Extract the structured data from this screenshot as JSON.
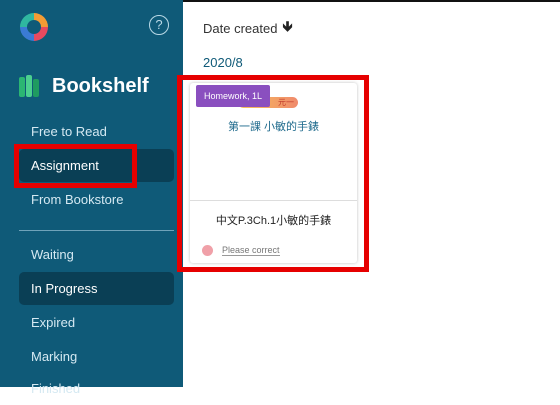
{
  "sidebar": {
    "help_label": "?",
    "brand": "Bookshelf",
    "items_top": [
      "Free to Read",
      "Assignment",
      "From Bookstore"
    ],
    "items_bottom": [
      "Waiting",
      "In Progress",
      "Expired",
      "Marking",
      "Finished"
    ]
  },
  "main": {
    "sort_label": "Date created",
    "group_date": "2020/8",
    "card": {
      "tag": "Homework, 1L",
      "cover_badge": "元一",
      "cover_title": "第一課 小敏的手錶",
      "name": "中文P.3Ch.1小敏的手錶",
      "status": "Please correct"
    }
  },
  "colors": {
    "sidebar_bg": "#0f5a78",
    "active_item_bg": "#0a3f55",
    "tag_bg": "#8a4fbf",
    "highlight": "#e60000",
    "status_dot": "#f0a0a8"
  },
  "icons": [
    "app-logo-icon",
    "help-icon",
    "bookshelf-icon",
    "arrow-down-icon",
    "status-dot-icon"
  ]
}
